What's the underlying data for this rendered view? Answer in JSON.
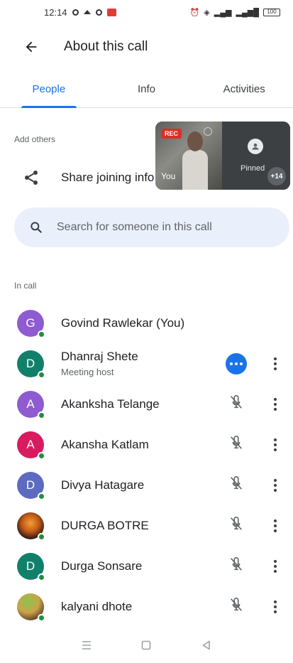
{
  "status_bar": {
    "time": "12:14",
    "battery": "100"
  },
  "header": {
    "title": "About this call"
  },
  "tabs": [
    {
      "label": "People",
      "active": true
    },
    {
      "label": "Info",
      "active": false
    },
    {
      "label": "Activities",
      "active": false
    }
  ],
  "add_others": {
    "label": "Add others",
    "share_label": "Share joining info"
  },
  "pip": {
    "rec_label": "REC",
    "self_label": "You",
    "other_label": "Pinned",
    "more_count": "+14"
  },
  "search": {
    "placeholder": "Search for someone in this call"
  },
  "in_call": {
    "label": "In call",
    "participants": [
      {
        "name": "Govind Rawlekar (You)",
        "initial": "G",
        "color": "#8e5bd0",
        "action": "none"
      },
      {
        "name": "Dhanraj Shete",
        "subtitle": "Meeting host",
        "initial": "D",
        "color": "#11806a",
        "action": "host"
      },
      {
        "name": "Akanksha Telange",
        "initial": "A",
        "color": "#8e5bd0",
        "action": "muted"
      },
      {
        "name": "Akansha Katlam",
        "initial": "A",
        "color": "#d81b60",
        "action": "muted"
      },
      {
        "name": "Divya Hatagare",
        "initial": "D",
        "color": "#5c6bc0",
        "action": "muted"
      },
      {
        "name": "DURGA BOTRE",
        "initial": "",
        "color": "photo1",
        "action": "muted"
      },
      {
        "name": "Durga Sonsare",
        "initial": "D",
        "color": "#11806a",
        "action": "muted"
      },
      {
        "name": "kalyani dhote",
        "initial": "",
        "color": "photo2",
        "action": "muted"
      }
    ]
  },
  "accent_color": "#1a73e8",
  "online_color": "#1e8e3e"
}
